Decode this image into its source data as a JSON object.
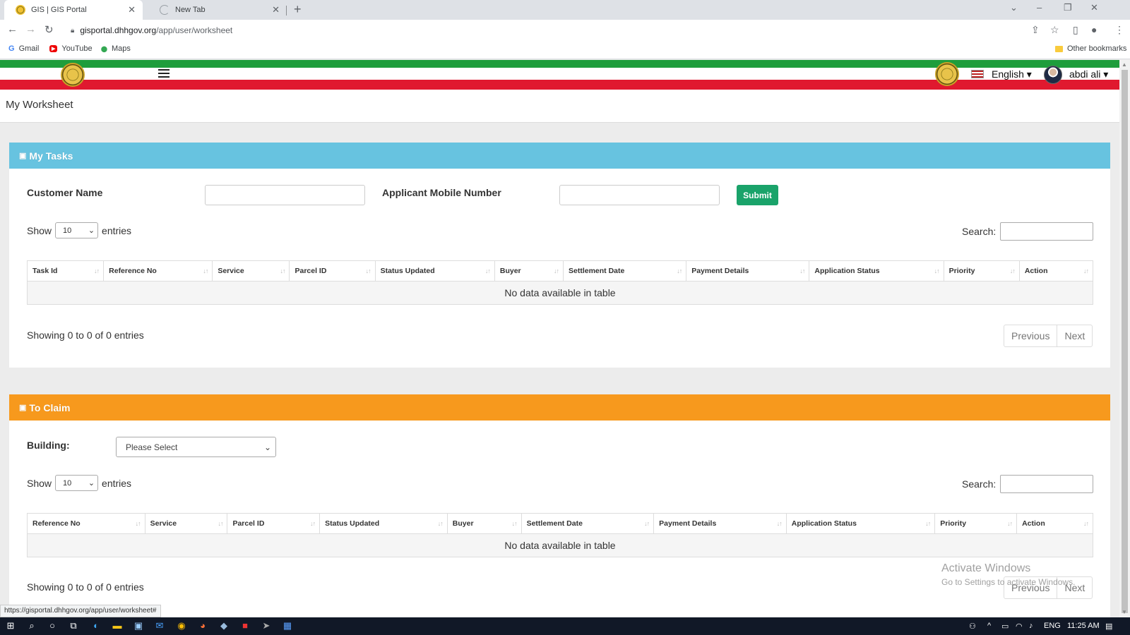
{
  "browser": {
    "tabs": [
      {
        "title": "GIS | GIS Portal",
        "close": "✕"
      },
      {
        "title": "New Tab",
        "close": "✕"
      }
    ],
    "new_tab": "+",
    "url_host": "gisportal.dhhgov.org",
    "url_path": "/app/user/worksheet",
    "bookmarks": [
      {
        "label": "Gmail",
        "icon": "G"
      },
      {
        "label": "YouTube",
        "icon": "▶"
      },
      {
        "label": "Maps",
        "icon": "⬤"
      }
    ],
    "other_bookmarks": "Other bookmarks",
    "status_url": "https://gisportal.dhhgov.org/app/user/worksheet#"
  },
  "header": {
    "language": "English ▾",
    "user": "abdi ali ▾"
  },
  "page": {
    "title": "My Worksheet"
  },
  "my_tasks": {
    "title": "My Tasks",
    "icon": "▣",
    "customer_name_label": "Customer Name",
    "mobile_label": "Applicant Mobile Number",
    "submit_label": "Submit",
    "show_label": "Show",
    "entries_label": "entries",
    "page_length": "10",
    "search_label": "Search:",
    "columns": [
      "Task Id",
      "Reference No",
      "Service",
      "Parcel ID",
      "Status Updated",
      "Buyer",
      "Settlement Date",
      "Payment Details",
      "Application Status",
      "Priority",
      "Action"
    ],
    "empty_text": "No data available in table",
    "showing": "Showing 0 to 0 of 0 entries",
    "prev_label": "Previous",
    "next_label": "Next",
    "color": "#67c3e0"
  },
  "to_claim": {
    "title": "To Claim",
    "icon": "▣",
    "building_label": "Building:",
    "building_value": "Please Select",
    "show_label": "Show",
    "entries_label": "entries",
    "page_length": "10",
    "search_label": "Search:",
    "columns": [
      "Reference No",
      "Service",
      "Parcel ID",
      "Status Updated",
      "Buyer",
      "Settlement Date",
      "Payment Details",
      "Application Status",
      "Priority",
      "Action"
    ],
    "empty_text": "No data available in table",
    "showing": "Showing 0 to 0 of 0 entries",
    "prev_label": "Previous",
    "next_label": "Next",
    "color": "#f7991d"
  },
  "watermark": {
    "line1": "Activate Windows",
    "line2": "Go to Settings to activate Windows."
  },
  "taskbar": {
    "language": "ENG",
    "time": "11:25 AM"
  }
}
